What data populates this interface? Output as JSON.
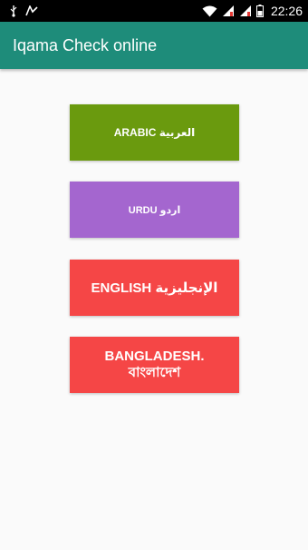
{
  "status_bar": {
    "time": "22:26",
    "icons": [
      "usb-icon",
      "notification-icon",
      "wifi-icon",
      "signal-icon",
      "signal-icon",
      "battery-icon"
    ]
  },
  "app_bar": {
    "title": "Iqama Check online"
  },
  "buttons": [
    {
      "label": "ARABIC العربية",
      "color": "#6a9a0e"
    },
    {
      "label": "URDU اردو",
      "color": "#a466cf"
    },
    {
      "label": "ENGLISH الإنجليزية",
      "color": "#f54646"
    },
    {
      "label_line1": "BANGLADESH.",
      "label_line2": "বাংলাদেশ",
      "color": "#f54646"
    }
  ]
}
